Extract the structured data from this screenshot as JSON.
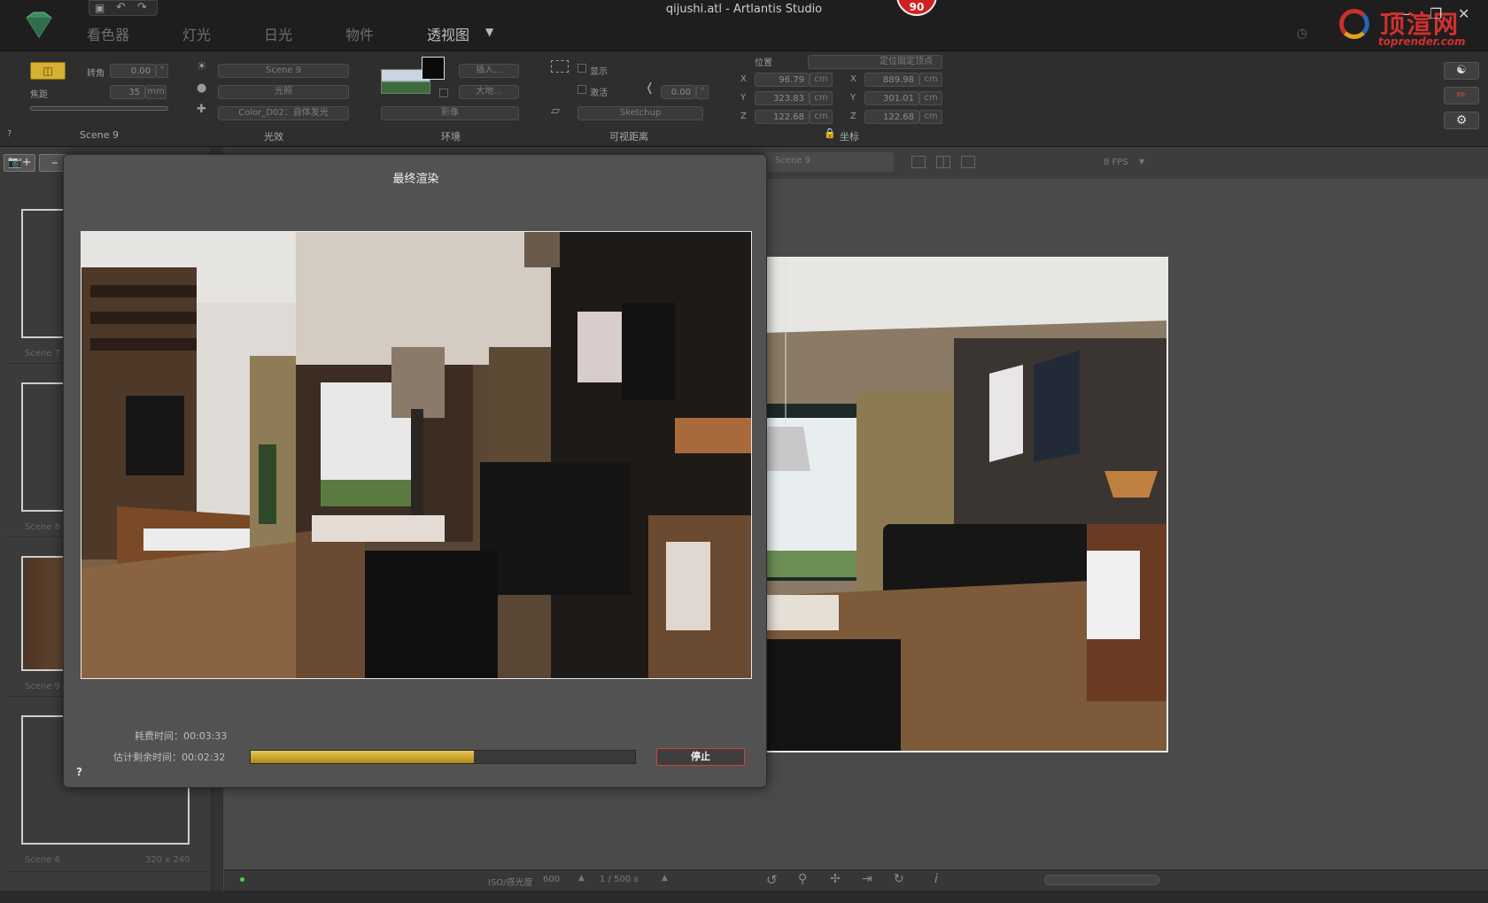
{
  "window": {
    "title": "qijushi.atl - Artlantis Studio",
    "badge": "90",
    "min": "–",
    "max": "❐",
    "close": "✕"
  },
  "quick_icons": [
    "save-icon",
    "undo-icon",
    "redo-icon"
  ],
  "tabs": [
    {
      "label": "看色器",
      "active": false
    },
    {
      "label": "灯光",
      "active": false
    },
    {
      "label": "日光",
      "active": false
    },
    {
      "label": "物件",
      "active": false
    },
    {
      "label": "透视图",
      "active": true
    }
  ],
  "watermark": {
    "name": "顶渲网",
    "url": "toprender.com"
  },
  "camera": {
    "angle_label": "转角",
    "angle_value": "0.00",
    "angle_unit": "°",
    "focal_label": "焦距",
    "focal_value": "35",
    "focal_unit": "mm",
    "section": "Scene 9"
  },
  "lighting": {
    "scene_select": "Scene 9",
    "light_select": "光照",
    "color_select": "Color_D02：自体发光",
    "section": "光效"
  },
  "environment": {
    "insert_btn": "插入...",
    "size_btn": "大地...",
    "image_select": "影像",
    "section": "环境"
  },
  "clipping": {
    "show_label": "显示",
    "activate_label": "激活",
    "value": "0.00",
    "value_unit": "°",
    "mode_select": "Sketchup",
    "section": "可视距离"
  },
  "coords": {
    "position_label": "位置",
    "mode_select": "定位固定顶点",
    "left": [
      {
        "axis": "X",
        "value": "96.79",
        "unit": "cm"
      },
      {
        "axis": "Y",
        "value": "323.83",
        "unit": "cm"
      },
      {
        "axis": "Z",
        "value": "122.68",
        "unit": "cm"
      }
    ],
    "right": [
      {
        "axis": "X",
        "value": "889.98",
        "unit": "cm"
      },
      {
        "axis": "Y",
        "value": "301.01",
        "unit": "cm"
      },
      {
        "axis": "Z",
        "value": "122.68",
        "unit": "cm"
      }
    ],
    "section": "坐标"
  },
  "help": "?",
  "sidebar": {
    "add_icon": "camera-add-icon",
    "remove": "–",
    "scenes": [
      {
        "label": "Scene 7"
      },
      {
        "label": "Scene 8"
      },
      {
        "label": "Scene 9",
        "size": ""
      },
      {
        "label": "Scene 6",
        "size": "320 x 240"
      }
    ]
  },
  "viewbar": {
    "scene": "Scene 9",
    "fps": "8 FPS"
  },
  "status": {
    "iso": "ISO/感光度",
    "iso_value": "600",
    "shutter": "1 / 500 s"
  },
  "dialog": {
    "title": "最终渲染",
    "elapsed_label": "耗费时间：00:03:33",
    "remaining_label": "估计剩余时间：00:02:32",
    "progress": 0.58,
    "stop_label": "停止",
    "help": "?"
  },
  "colors": {
    "accent_gold": "#d6b030",
    "badge_red": "#d22020",
    "stop_border": "#d64040"
  }
}
